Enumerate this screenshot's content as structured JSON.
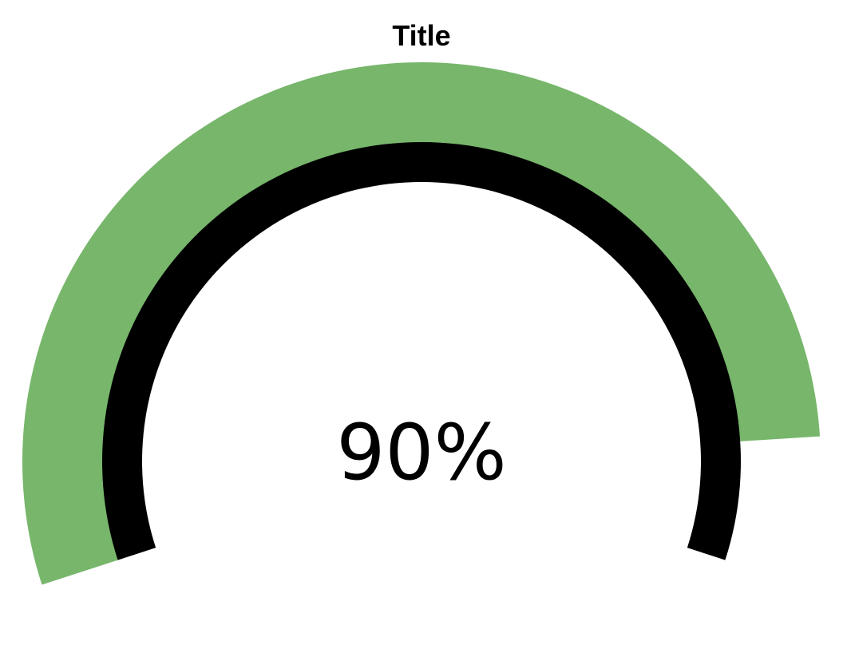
{
  "chart_data": {
    "type": "gauge",
    "title": "Title",
    "value": 90,
    "value_label": "90%",
    "range": [
      0,
      100
    ],
    "colors": {
      "value_arc": "#77b66b",
      "track_arc": "#000000",
      "background": "#ffffff"
    }
  }
}
